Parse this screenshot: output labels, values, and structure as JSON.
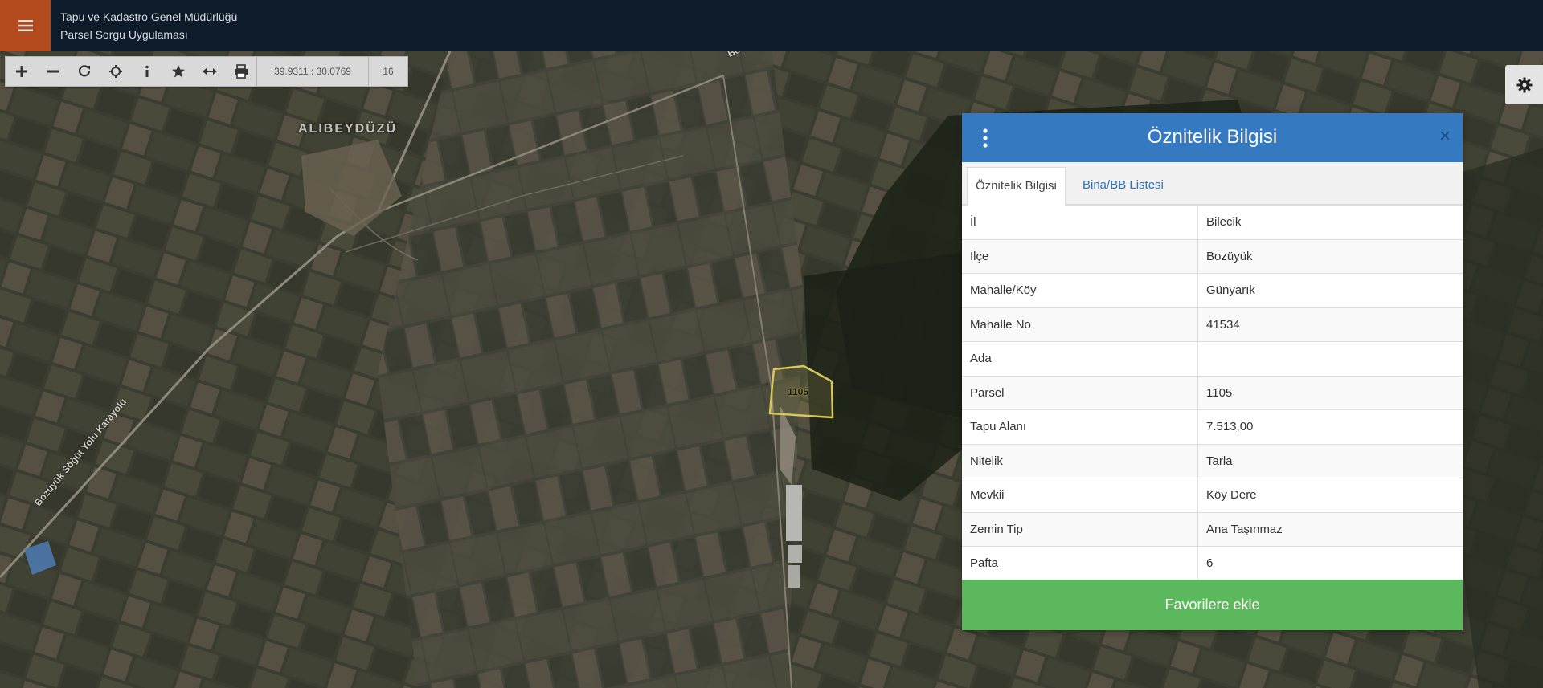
{
  "header": {
    "org": "Tapu ve Kadastro Genel Müdürlüğü",
    "app": "Parsel Sorgu Uygulaması",
    "menu_icon": "hamburger-icon"
  },
  "toolbar": {
    "buttons": [
      "zoom-in-icon",
      "zoom-out-icon",
      "refresh-icon",
      "locate-icon",
      "info-icon",
      "favorites-icon",
      "measure-icon",
      "print-icon"
    ],
    "coordinates": "39.9311 : 30.0769",
    "zoom_level": "16"
  },
  "map": {
    "place_label": "ALIBEYDÜZÜ",
    "road_label": "Bozüyük Söğüt Yolu Karayolu",
    "road_label_top": "Boz",
    "parcel_label": "1105",
    "parcel_color": "#d8c85a"
  },
  "panel": {
    "title": "Öznitelik Bilgisi",
    "close": "×",
    "tabs": [
      "Öznitelik Bilgisi",
      "Bina/BB Listesi"
    ],
    "rows": [
      {
        "key": "İl",
        "value": "Bilecik"
      },
      {
        "key": "İlçe",
        "value": "Bozüyük"
      },
      {
        "key": "Mahalle/Köy",
        "value": "Günyarık"
      },
      {
        "key": "Mahalle No",
        "value": "41534"
      },
      {
        "key": "Ada",
        "value": ""
      },
      {
        "key": "Parsel",
        "value": "1105"
      },
      {
        "key": "Tapu Alanı",
        "value": "7.513,00"
      },
      {
        "key": "Nitelik",
        "value": "Tarla"
      },
      {
        "key": "Mevkii",
        "value": "Köy Dere"
      },
      {
        "key": "Zemin Tip",
        "value": "Ana Taşınmaz"
      },
      {
        "key": "Pafta",
        "value": "6"
      }
    ],
    "favorite_button": "Favorilere ekle"
  },
  "colors": {
    "header_bg": "#0d1b2a",
    "menu_bg": "#b24a1e",
    "panel_header": "#3579c1",
    "favorite_green": "#5cb85c"
  }
}
